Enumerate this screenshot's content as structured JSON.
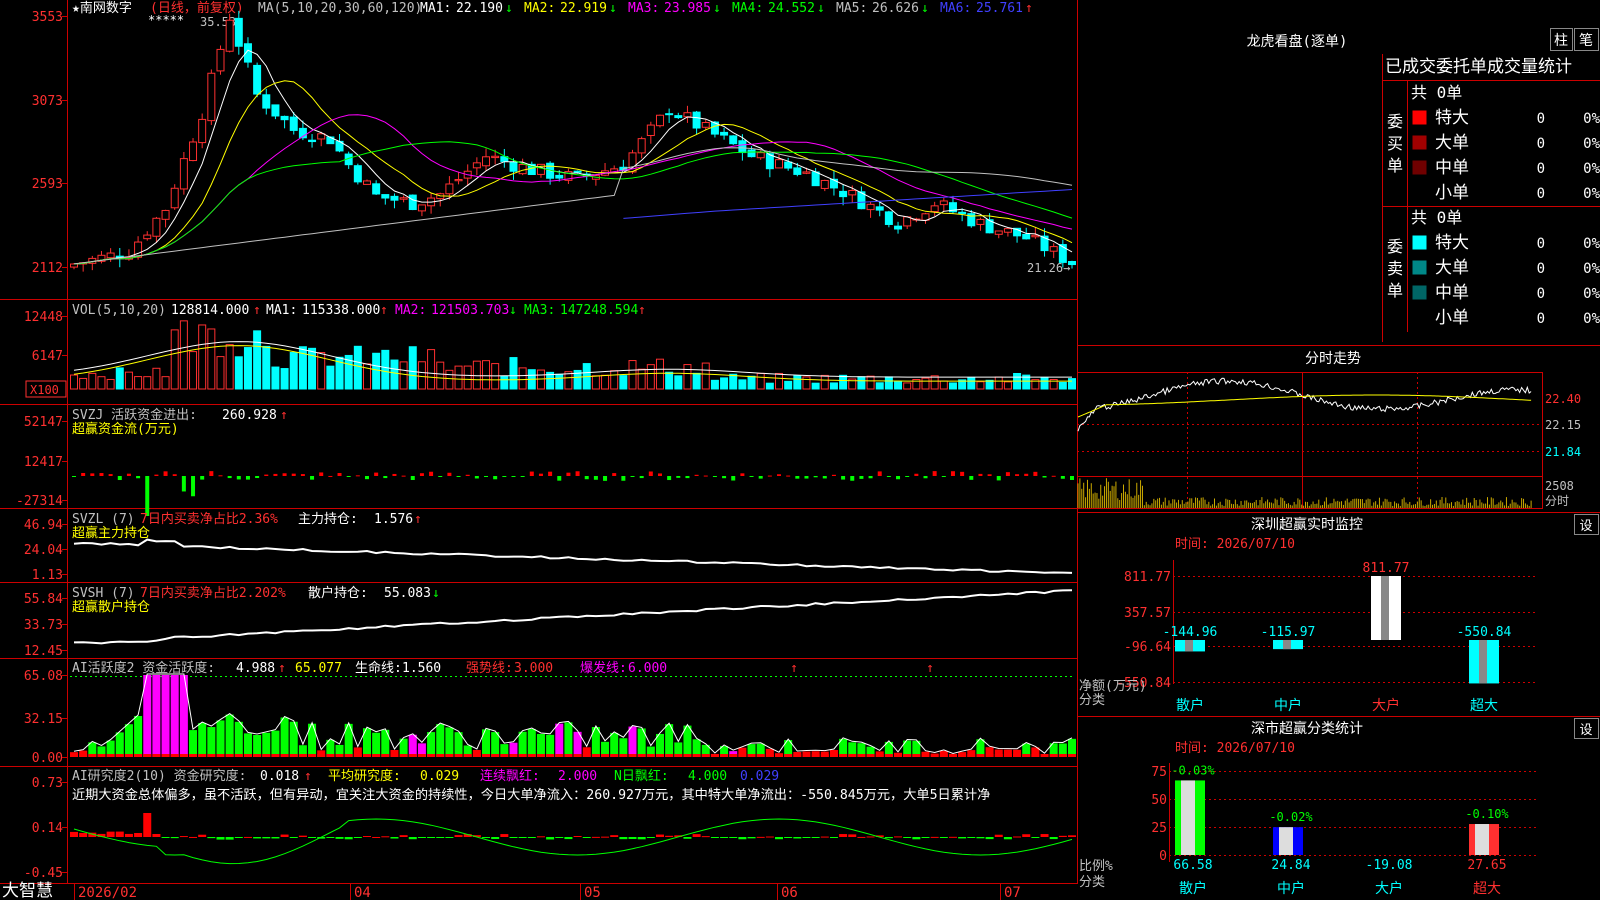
{
  "stock": {
    "title": "★南网数字",
    "period_label": "(日线，前复权)",
    "stars": "*****",
    "high_label": "35.53",
    "low_label": "21.26→",
    "ma_title": "MA(5,10,20,30,60,120)",
    "ma": [
      {
        "label": "MA1:",
        "value": "22.190",
        "arrow": "↓",
        "color": "#ffffff"
      },
      {
        "label": "MA2:",
        "value": "22.919",
        "arrow": "↓",
        "color": "#ffff00"
      },
      {
        "label": "MA3:",
        "value": "23.985",
        "arrow": "↓",
        "color": "#ff00ff"
      },
      {
        "label": "MA4:",
        "value": "24.552",
        "arrow": "↓",
        "color": "#00ff00"
      },
      {
        "label": "MA5:",
        "value": "26.626",
        "arrow": "↓",
        "color": "#c0c0c0"
      },
      {
        "label": "MA6:",
        "value": "25.761",
        "arrow": "↑",
        "color": "#4040ff"
      }
    ],
    "y_ticks": [
      "3553",
      "3073",
      "2593",
      "2112"
    ],
    "range": {
      "min": 21.0,
      "max": 36.2
    }
  },
  "volume": {
    "title": "VOL(5,10,20)",
    "value": "128814.000",
    "arrow": "↑",
    "ma": [
      {
        "label": "MA1:",
        "value": "115338.000",
        "arrow": "↑",
        "color": "#ffffff"
      },
      {
        "label": "MA2:",
        "value": "121503.703",
        "arrow": "↓",
        "color": "#ff00ff"
      },
      {
        "label": "MA3:",
        "value": "147248.594",
        "arrow": "↑",
        "color": "#00ff00"
      }
    ],
    "y_ticks": [
      "12448",
      "6147"
    ],
    "unit_label": "X100"
  },
  "svzj": {
    "title": "SVZJ  活跃资金进出:",
    "value": "260.928",
    "arrow": "↑",
    "subtitle": "超赢资金流(万元)",
    "y_ticks": [
      "52147",
      "12417",
      "-27314"
    ]
  },
  "svzl": {
    "title": "SVZL (7)",
    "title2": "7日内买卖净占比2.36%",
    "label": "主力持仓:",
    "value": "1.576",
    "arrow": "↑",
    "subtitle": "超赢主力持仓",
    "y_ticks": [
      "46.94",
      "24.04",
      "1.13"
    ]
  },
  "svsh": {
    "title": "SVSH (7)",
    "title2": "7日内买卖净占比2.202%",
    "label": "散户持仓:",
    "value": "55.083",
    "arrow": "↓",
    "subtitle": "超赢散户持仓",
    "y_ticks": [
      "55.84",
      "33.73",
      "12.45"
    ]
  },
  "ai_active": {
    "title": "AI活跃度2 资金活跃度:",
    "value": "4.988",
    "arrow": "↑",
    "v2": "65.077",
    "life_label": "生命线:",
    "life": "1.560",
    "strong_label": "强势线:",
    "strong": "3.000",
    "burst_label": "爆发线:",
    "burst": "6.000",
    "y_ticks": [
      "65.08",
      "32.15",
      "0.00"
    ]
  },
  "ai_research": {
    "title": "AI研究度2(10) 资金研究度:",
    "value": "0.018",
    "arrow": "↑",
    "avg_label": "平均研究度:",
    "avg": "0.029",
    "streak_label": "连续飘红:",
    "streak": "2.000",
    "n_label": "N日飘红:",
    "n": "4.000",
    "last": "0.029",
    "comment": "近期大资金总体偏多，虽不活跃，但有异动，宜关注大资金的持续性，今日大单净流入：260.927万元，其中特大单净流出：-550.845万元，大单5日累计净",
    "y_ticks": [
      "0.73",
      "0.14",
      "-0.45"
    ]
  },
  "xaxis": {
    "brand": "大智慧",
    "labels": [
      "2026/02",
      "04",
      "05",
      "06",
      "07"
    ]
  },
  "right": {
    "lhb": {
      "title": "龙虎看盘(逐单)",
      "btn1": "柱",
      "btn2": "笔"
    },
    "orders": {
      "header": "已成交委托单成交量统计",
      "buy_side": "委买单",
      "sell_side": "委卖单",
      "buy_total": "共 0单",
      "sell_total": "共 0单",
      "buy_rows": [
        {
          "name": "特大",
          "count": "0",
          "pct": "0%",
          "color": "#ff0000"
        },
        {
          "name": "大单",
          "count": "0",
          "pct": "0%",
          "color": "#a00000"
        },
        {
          "name": "中单",
          "count": "0",
          "pct": "0%",
          "color": "#700000"
        },
        {
          "name": "小单",
          "count": "0",
          "pct": "0%",
          "color": "#000000"
        }
      ],
      "sell_rows": [
        {
          "name": "特大",
          "count": "0",
          "pct": "0%",
          "color": "#00ffff"
        },
        {
          "name": "大单",
          "count": "0",
          "pct": "0%",
          "color": "#008888"
        },
        {
          "name": "中单",
          "count": "0",
          "pct": "0%",
          "color": "#006666"
        },
        {
          "name": "小单",
          "count": "0",
          "pct": "0%",
          "color": "#000000"
        }
      ]
    },
    "intraday": {
      "title": "分时走势",
      "y_ticks": [
        "22.40",
        "22.15",
        "21.84"
      ],
      "vol_tick": "2508",
      "vol_label": "分时"
    },
    "monitor": {
      "title": "深圳超赢实时监控",
      "btn": "设",
      "time": "时间: 2026/07/10",
      "y_ticks": [
        "811.77",
        "357.57",
        "-96.64",
        "-550.84"
      ],
      "unit": "净额(万元)",
      "cat_label": "分类",
      "bars": [
        {
          "name": "散户",
          "value": -144.96,
          "label": "-144.96"
        },
        {
          "name": "中户",
          "value": -115.97,
          "label": "-115.97"
        },
        {
          "name": "大户",
          "value": 811.77,
          "label": "811.77"
        },
        {
          "name": "超大",
          "value": -550.84,
          "label": "-550.84"
        }
      ]
    },
    "classify": {
      "title": "深市超赢分类统计",
      "btn": "设",
      "time": "时间: 2026/07/10",
      "y_ticks": [
        "75",
        "50",
        "25",
        "0"
      ],
      "unit": "比例%",
      "cat_label": "分类",
      "bars": [
        {
          "name": "散户",
          "value": 66.58,
          "label": "66.58",
          "change": "-0.03%"
        },
        {
          "name": "中户",
          "value": 24.84,
          "label": "24.84",
          "change": "-0.02%"
        },
        {
          "name": "大户",
          "value": -19.08,
          "label": "-19.08",
          "change": ""
        },
        {
          "name": "超大",
          "value": 27.65,
          "label": "27.65",
          "change": "-0.10%"
        }
      ]
    }
  },
  "colors": {
    "up": "#ff3030",
    "down": "#00ffff",
    "frame": "#cc0000",
    "label": "#c0c0c0",
    "yellow": "#ffff00"
  }
}
